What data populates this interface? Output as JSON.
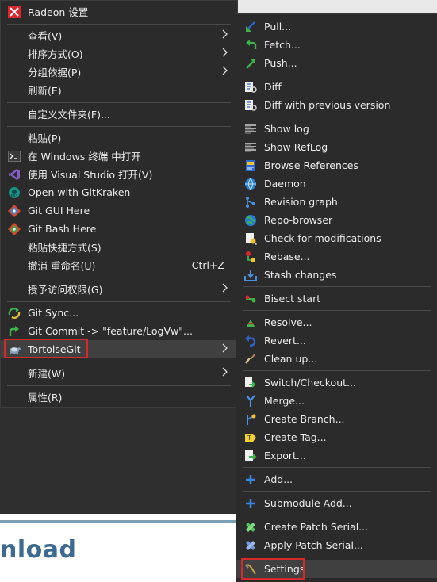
{
  "background": {
    "heading": "nload"
  },
  "main_menu": {
    "header": "Radeon 设置",
    "items": [
      {
        "label": "查看(V)"
      },
      {
        "label": "排序方式(O)"
      },
      {
        "label": "分组依据(P)"
      },
      {
        "label": "刷新(E)"
      },
      {
        "label": "自定义文件夹(F)..."
      },
      {
        "label": "粘贴(P)"
      },
      {
        "label": "在 Windows 终端 中打开"
      },
      {
        "label": "使用 Visual Studio 打开(V)"
      },
      {
        "label": "Open with GitKraken"
      },
      {
        "label": "Git GUI Here"
      },
      {
        "label": "Git Bash Here"
      },
      {
        "label": "粘贴快捷方式(S)"
      },
      {
        "label": "撤消 重命名(U)",
        "shortcut": "Ctrl+Z"
      },
      {
        "label": "授予访问权限(G)"
      },
      {
        "label": "Git Sync..."
      },
      {
        "label": "Git Commit -> \"feature/LogVw\"..."
      },
      {
        "label": "TortoiseGit"
      },
      {
        "label": "新建(W)"
      },
      {
        "label": "属性(R)"
      }
    ]
  },
  "sub_menu": {
    "items": [
      {
        "label": "Pull..."
      },
      {
        "label": "Fetch..."
      },
      {
        "label": "Push..."
      },
      {
        "label": "Diff"
      },
      {
        "label": "Diff with previous version"
      },
      {
        "label": "Show log"
      },
      {
        "label": "Show RefLog"
      },
      {
        "label": "Browse References"
      },
      {
        "label": "Daemon"
      },
      {
        "label": "Revision graph"
      },
      {
        "label": "Repo-browser"
      },
      {
        "label": "Check for modifications"
      },
      {
        "label": "Rebase..."
      },
      {
        "label": "Stash changes"
      },
      {
        "label": "Bisect start"
      },
      {
        "label": "Resolve..."
      },
      {
        "label": "Revert..."
      },
      {
        "label": "Clean up..."
      },
      {
        "label": "Switch/Checkout..."
      },
      {
        "label": "Merge..."
      },
      {
        "label": "Create Branch..."
      },
      {
        "label": "Create Tag..."
      },
      {
        "label": "Export..."
      },
      {
        "label": "Add..."
      },
      {
        "label": "Submodule Add..."
      },
      {
        "label": "Create Patch Serial..."
      },
      {
        "label": "Apply Patch Serial..."
      },
      {
        "label": "Settings"
      }
    ]
  }
}
